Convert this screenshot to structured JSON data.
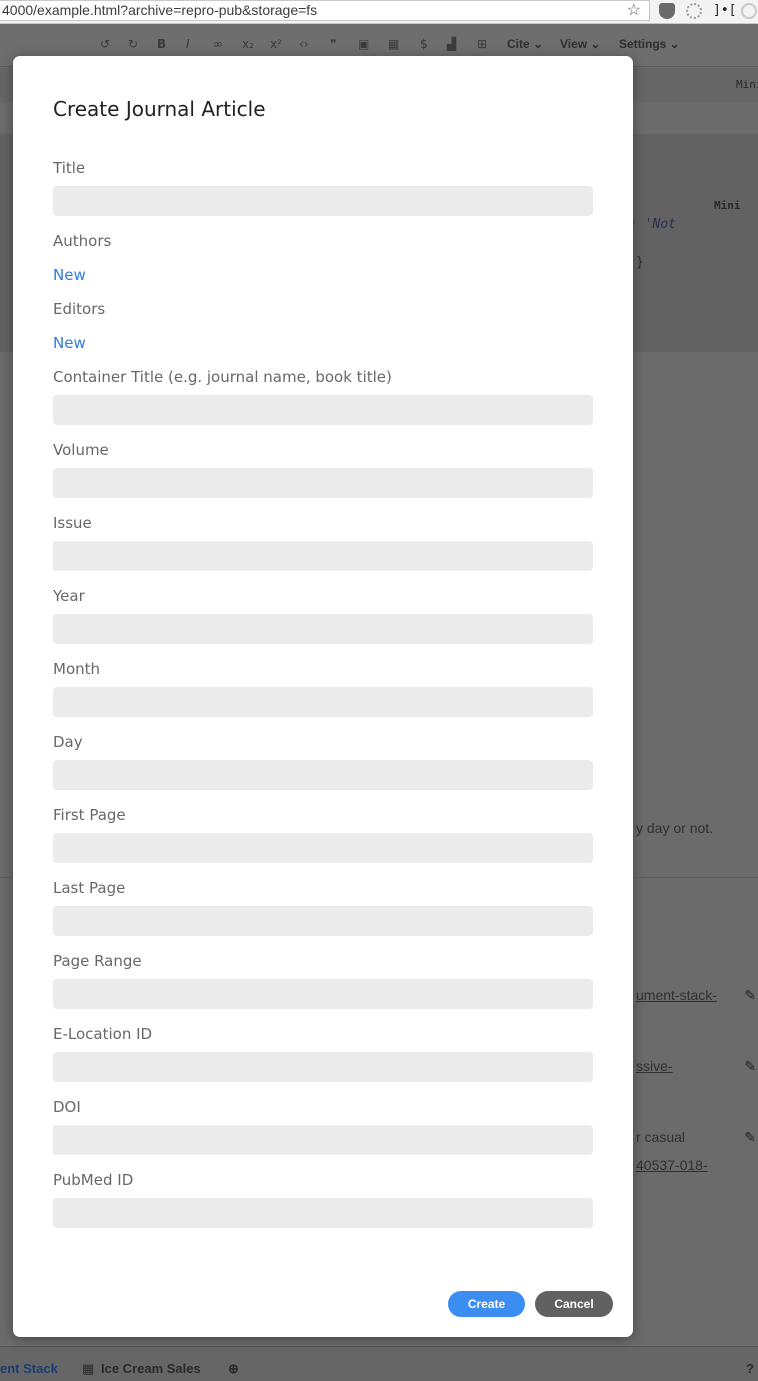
{
  "browser": {
    "url": "4000/example.html?archive=repro-pub&storage=fs",
    "star_icon": "star-icon"
  },
  "app": {
    "toolbar": {
      "cite_label": "Cite",
      "view_label": "View",
      "settings_label": "Settings"
    },
    "background": {
      "mini_label_top": "Mini",
      "mini_label_code": "Mini",
      "code_line_1": ": 'Not",
      "code_line_2": "}",
      "text_day": "y day or not.",
      "link_1": "ument-stack-",
      "link_2": "ssive-",
      "text_casual": "r casual",
      "link_3": "40537-018-"
    },
    "bottom_tabs": [
      {
        "label": "ent Stack"
      },
      {
        "label": "Ice Cream Sales"
      }
    ]
  },
  "modal": {
    "title": "Create Journal Article",
    "fields": {
      "title": "Title",
      "authors": "Authors",
      "editors": "Editors",
      "container_title": "Container Title (e.g. journal name, book title)",
      "volume": "Volume",
      "issue": "Issue",
      "year": "Year",
      "month": "Month",
      "day": "Day",
      "first_page": "First Page",
      "last_page": "Last Page",
      "page_range": "Page Range",
      "elocation_id": "E-Location ID",
      "doi": "DOI",
      "pubmed_id": "PubMed ID"
    },
    "new_label": "New",
    "buttons": {
      "create": "Create",
      "cancel": "Cancel"
    }
  },
  "colors": {
    "accent": "#3c8df2",
    "link": "#2d7de1",
    "input_bg": "#ebebeb",
    "overlay": "#6b6b6b"
  }
}
